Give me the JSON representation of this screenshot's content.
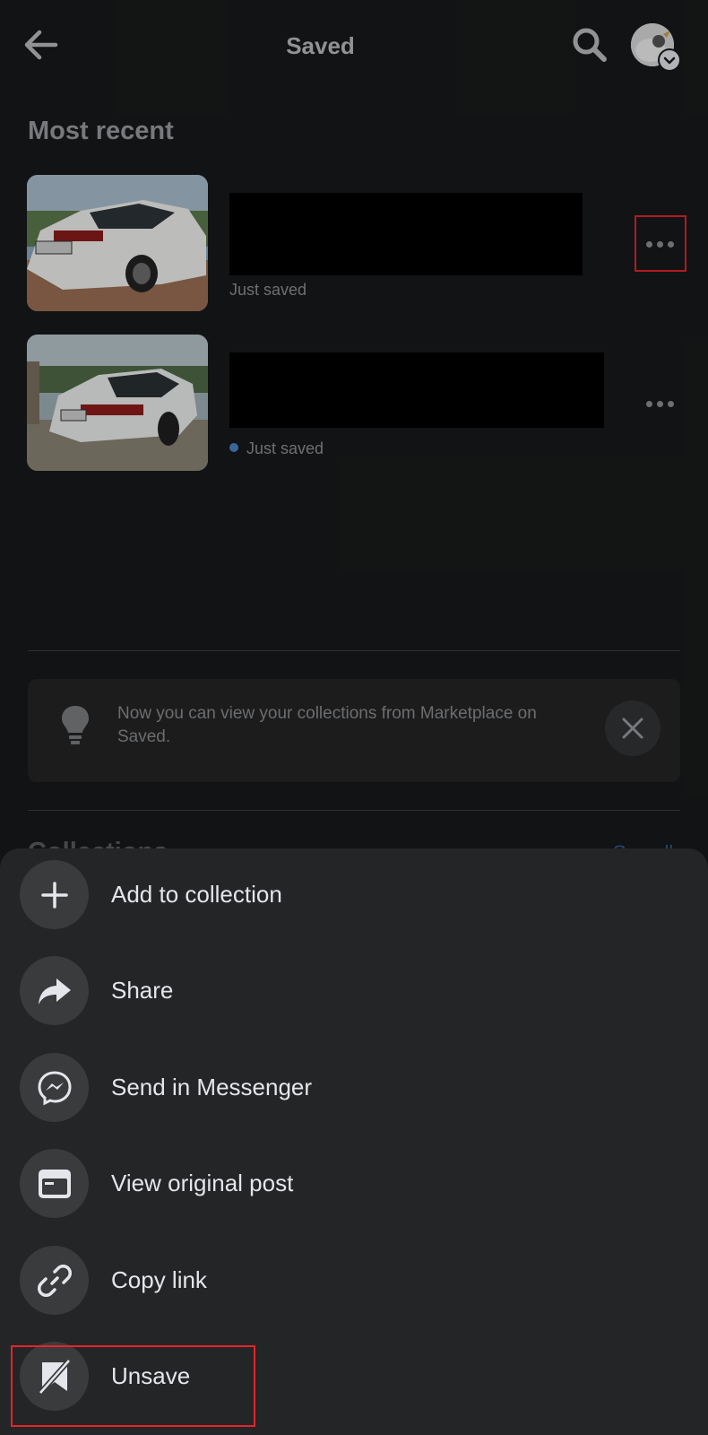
{
  "header": {
    "title": "Saved",
    "back_icon": "arrow-left-icon",
    "search_icon": "search-icon"
  },
  "most_recent": {
    "title": "Most recent",
    "items": [
      {
        "status": "Just saved",
        "unread_dot": false
      },
      {
        "status": "Just saved",
        "unread_dot": true
      }
    ]
  },
  "notice": {
    "text": "Now you can view your collections from Marketplace on Saved.",
    "icon": "lightbulb-icon"
  },
  "collections": {
    "title": "Collections",
    "see_all": "See all"
  },
  "sheet": {
    "items": [
      {
        "label": "Add to collection",
        "icon": "plus-icon"
      },
      {
        "label": "Share",
        "icon": "share-arrow-icon"
      },
      {
        "label": "Send in Messenger",
        "icon": "messenger-icon"
      },
      {
        "label": "View original post",
        "icon": "browser-window-icon"
      },
      {
        "label": "Copy link",
        "icon": "link-icon"
      },
      {
        "label": "Unsave",
        "icon": "unsave-icon"
      }
    ]
  },
  "colors": {
    "background": "#18191a",
    "sheet": "#242526",
    "highlight": "#e5242b",
    "unread_dot": "#4b84c4"
  }
}
